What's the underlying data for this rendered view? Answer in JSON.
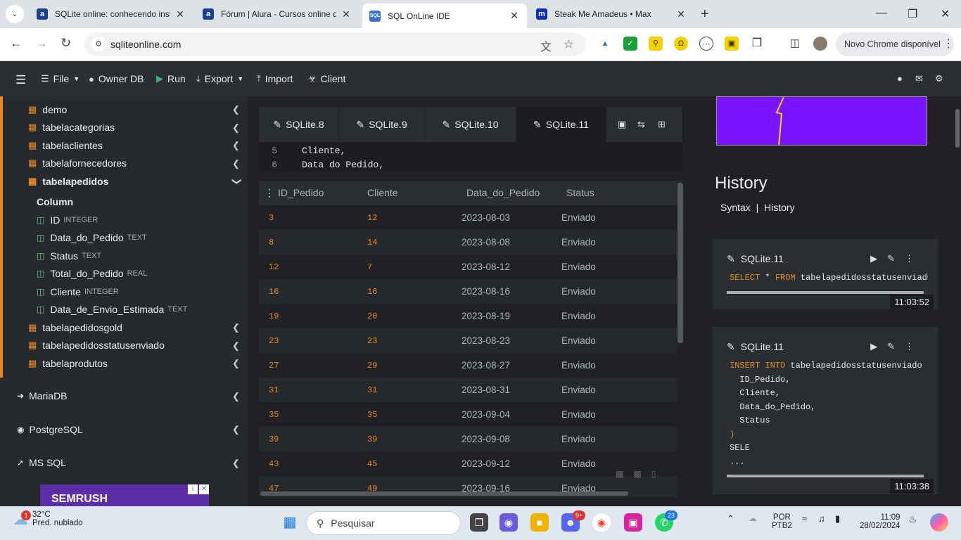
{
  "browser": {
    "tabs": [
      {
        "title": "SQLite online: conhecendo inst",
        "icon": "alura-icon",
        "color": "#1c3f91"
      },
      {
        "title": "Fórum | Alura - Cursos online d",
        "icon": "alura-icon",
        "color": "#1c3f91"
      },
      {
        "title": "SQL OnLine IDE",
        "icon": "sqlonline-icon",
        "color": "#3b73d1"
      },
      {
        "title": "Steak Me Amadeus • Max",
        "icon": "max-icon",
        "color": "#0a2eb5"
      }
    ],
    "url": "sqliteonline.com",
    "update_label": "Novo Chrome disponível"
  },
  "appbar": {
    "file": "File",
    "owner_db": "Owner DB",
    "run": "Run",
    "export": "Export",
    "import": "Import",
    "client": "Client"
  },
  "sidebar": {
    "tables_top": [
      "demo",
      "tabelacategorias",
      "tabelaclientes",
      "tabelafornecedores"
    ],
    "expanded_table": "tabelapedidos",
    "column_header": "Column",
    "columns": [
      {
        "name": "ID",
        "type": "INTEGER"
      },
      {
        "name": "Data_do_Pedido",
        "type": "TEXT"
      },
      {
        "name": "Status",
        "type": "TEXT"
      },
      {
        "name": "Total_do_Pedido",
        "type": "REAL"
      },
      {
        "name": "Cliente",
        "type": "INTEGER"
      },
      {
        "name": "Data_de_Envio_Estimada",
        "type": "TEXT"
      }
    ],
    "tables_bottom": [
      "tabelapedidosgold",
      "tabelapedidosstatusenviado",
      "tabelaprodutos"
    ],
    "databases": [
      "MariaDB",
      "PostgreSQL",
      "MS SQL"
    ],
    "ad_label": "SEMRUSH"
  },
  "editor": {
    "tabs": [
      "SQLite.8",
      "SQLite.9",
      "SQLite.10",
      "SQLite.11"
    ],
    "active_tab": "SQLite.11",
    "lines": [
      {
        "n": "5",
        "code": "Cliente,"
      },
      {
        "n": "6",
        "code": "Data do Pedido,"
      }
    ]
  },
  "grid": {
    "headers": [
      "ID_Pedido",
      "Cliente",
      "Data_do_Pedido",
      "Status"
    ],
    "rows": [
      [
        "3",
        "12",
        "2023-08-03",
        "Enviado"
      ],
      [
        "8",
        "14",
        "2023-08-08",
        "Enviado"
      ],
      [
        "12",
        "7",
        "2023-08-12",
        "Enviado"
      ],
      [
        "16",
        "16",
        "2023-08-16",
        "Enviado"
      ],
      [
        "19",
        "20",
        "2023-08-19",
        "Enviado"
      ],
      [
        "23",
        "23",
        "2023-08-23",
        "Enviado"
      ],
      [
        "27",
        "29",
        "2023-08-27",
        "Enviado"
      ],
      [
        "31",
        "31",
        "2023-08-31",
        "Enviado"
      ],
      [
        "35",
        "35",
        "2023-09-04",
        "Enviado"
      ],
      [
        "39",
        "39",
        "2023-09-08",
        "Enviado"
      ],
      [
        "43",
        "45",
        "2023-09-12",
        "Enviado"
      ],
      [
        "47",
        "49",
        "2023-09-16",
        "Enviado"
      ]
    ]
  },
  "history": {
    "title": "History",
    "link_syntax": "Syntax",
    "link_sep": "|",
    "link_history": "History",
    "cards": [
      {
        "name": "SQLite.11",
        "time": "11:03:52"
      },
      {
        "name": "SQLite.11",
        "time": "11:03:38"
      }
    ],
    "card1_code": {
      "kw1": "SELECT",
      "mid": " * ",
      "kw2": "FROM",
      "rest": " tabelapedidosstatusenviado"
    },
    "card2_code": {
      "kw1": "INSERT",
      "kw2": "INTO",
      "table": " tabelapedidosstatusenviado",
      "lines": [
        "  ID_Pedido,",
        "  Cliente,",
        "  Data_do_Pedido,",
        "  Status",
        ")",
        "SELE",
        "..."
      ]
    }
  },
  "taskbar": {
    "temp": "32°C",
    "weather": "Pred. nublado",
    "badge": "1",
    "search": "Pesquisar",
    "lang1": "POR",
    "lang2": "PTB2",
    "time": "11:09",
    "date": "28/02/2024",
    "discord_badge": "9+",
    "whatsapp_badge": "23"
  }
}
